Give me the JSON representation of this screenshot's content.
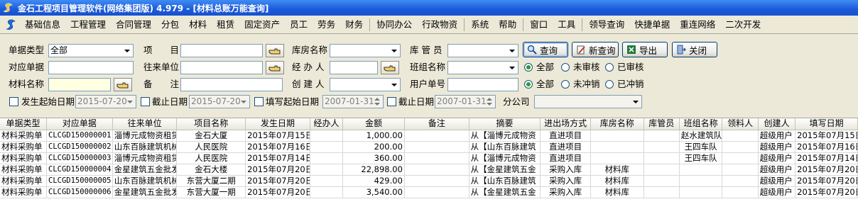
{
  "window": {
    "title": "金石工程项目管理软件(网络集团版) 4.979 - [材料总账万能查询]"
  },
  "menu": [
    "基础信息",
    "工程管理",
    "合同管理",
    "分包",
    "材料",
    "租赁",
    "固定资产",
    "员工",
    "劳务",
    "财务",
    "协同办公",
    "行政物资",
    "系统",
    "帮助",
    "窗口",
    "工具",
    "领导查询",
    "快捷单据",
    "重连网络",
    "二次开发"
  ],
  "filters": {
    "doc_type_label": "单据类型",
    "doc_type_value": "全部",
    "project_label": "项　　目",
    "warehouse_label": "库房名称",
    "keeper_label": "库 管 员",
    "counter_doc_label": "对应单据",
    "partner_label": "往来单位",
    "handler_label": "经 办 人",
    "team_label": "班组名称",
    "material_label": "材料名称",
    "remark_label": "备　　注",
    "creator_label": "创 建 人",
    "user_doc_label": "用户单号",
    "audit_all": "全部",
    "audit_no": "未审核",
    "audit_yes": "已审核",
    "offset_all": "全部",
    "offset_no": "未冲销",
    "offset_yes": "已冲销",
    "occur_start_label": "发生起始日期",
    "occur_start_value": "2015-07-20",
    "occur_end_label": "截止日期",
    "occur_end_value": "2015-07-20",
    "fill_start_label": "填写起始日期",
    "fill_start_value": "2007-01-31",
    "fill_end_label": "截止日期",
    "fill_end_value": "2007-01-31",
    "branch_label": "分公司"
  },
  "buttons": {
    "query": "查询",
    "new_query": "新查询",
    "export": "导出",
    "close": "关闭"
  },
  "table": {
    "columns": [
      "单据类型",
      "对应单据",
      "往来单位",
      "项目名称",
      "发生日期",
      "经办人",
      "金额",
      "备注",
      "摘要",
      "进出场方式",
      "库房名称",
      "库管员",
      "班组名称",
      "领料人",
      "创建人",
      "填写日期"
    ],
    "rows": [
      [
        "材料采购单",
        "CLCGD150000001",
        "淄博元成物资租赁",
        "金石大厦",
        "2015年07月15日",
        "",
        "1,000.00",
        "",
        "从【淄博元成物资",
        "直进项目",
        "",
        "",
        "赵水建筑队",
        "",
        "超级用户",
        "2015年07月15日"
      ],
      [
        "材料采购单",
        "CLCGD150000002",
        "山东百脉建筑机械",
        "人民医院",
        "2015年07月16日",
        "",
        "200.00",
        "",
        "从【山东百脉建筑",
        "直进项目",
        "",
        "",
        "王四车队",
        "",
        "超级用户",
        "2015年07月16日"
      ],
      [
        "材料采购单",
        "CLCGD150000003",
        "淄博元成物资租赁",
        "人民医院",
        "2015年07月14日",
        "",
        "360.00",
        "",
        "从【淄博元成物资",
        "直进项目",
        "",
        "",
        "王四车队",
        "",
        "超级用户",
        "2015年07月14日"
      ],
      [
        "材料采购单",
        "CLCGD150000004",
        "金星建筑五金批发",
        "金石大楼",
        "2015年07月20日",
        "",
        "22,898.00",
        "",
        "从【金星建筑五金",
        "采购入库",
        "材料库",
        "",
        "",
        "",
        "超级用户",
        "2015年07月20日"
      ],
      [
        "材料采购单",
        "CLCGD150000005",
        "山东百脉建筑机械",
        "东营大厦二期",
        "2015年07月20日",
        "",
        "429.00",
        "",
        "从【山东百脉建筑",
        "采购入库",
        "材料库",
        "",
        "",
        "",
        "超级用户",
        "2015年07月20日"
      ],
      [
        "材料采购单",
        "CLCGD150000006",
        "金星建筑五金批发",
        "东营大厦一期",
        "2015年07月20日",
        "",
        "3,540.00",
        "",
        "从【金星建筑五金",
        "采购入库",
        "材料库",
        "",
        "",
        "",
        "超级用户",
        "2015年07月20日"
      ]
    ]
  }
}
